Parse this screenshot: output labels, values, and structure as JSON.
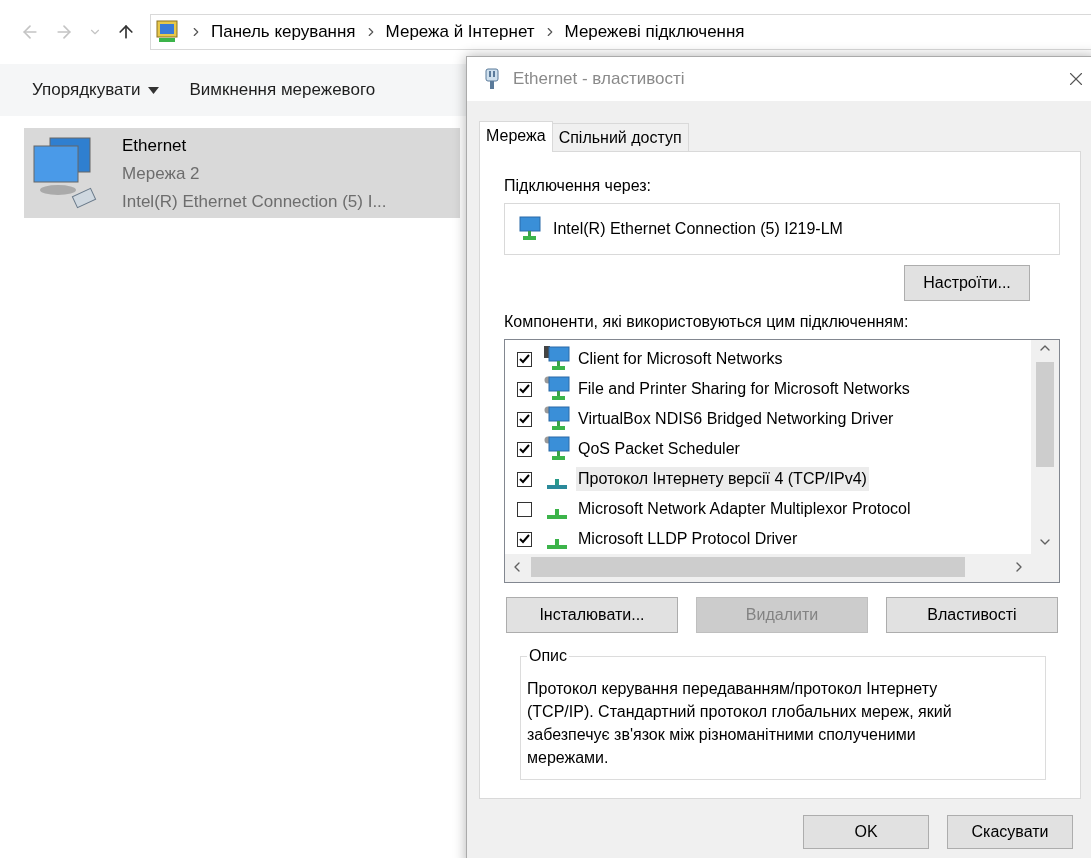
{
  "explorer": {
    "breadcrumb": [
      "Панель керування",
      "Мережа й Інтернет",
      "Мережеві підключення"
    ],
    "toolbar": [
      {
        "label": "Упорядкувати",
        "dropdown": true
      },
      {
        "label": "Вимкнення мережевого",
        "dropdown": false
      }
    ],
    "items": [
      {
        "name": "Ethernet",
        "network": "Мережа 2",
        "adapter": "Intel(R) Ethernet Connection (5) I...",
        "selected": true
      }
    ]
  },
  "dialog": {
    "title": "Ethernet - властивості",
    "tabs": [
      {
        "label": "Мережа",
        "selected": true
      },
      {
        "label": "Спільний доступ",
        "selected": false
      }
    ],
    "connect_using_label": "Підключення через:",
    "adapter": "Intel(R) Ethernet Connection (5) I219-LM",
    "configure_button": "Настроїти...",
    "components_label": "Компоненти, які використовуються цим підключенням:",
    "components": [
      {
        "label": "Client for Microsoft Networks",
        "kind": "client",
        "checked": true,
        "selected": false
      },
      {
        "label": "File and Printer Sharing for Microsoft Networks",
        "kind": "service",
        "checked": true,
        "selected": false
      },
      {
        "label": "VirtualBox NDIS6 Bridged Networking Driver",
        "kind": "service",
        "checked": true,
        "selected": false
      },
      {
        "label": "QoS Packet Scheduler",
        "kind": "service",
        "checked": true,
        "selected": false
      },
      {
        "label": "Протокол Інтернету версії 4 (TCP/IPv4)",
        "kind": "protocol",
        "checked": true,
        "selected": true
      },
      {
        "label": "Microsoft Network Adapter Multiplexor Protocol",
        "kind": "protocol",
        "checked": false,
        "selected": false
      },
      {
        "label": "Microsoft LLDP Protocol Driver",
        "kind": "protocol",
        "checked": true,
        "selected": false
      }
    ],
    "buttons": [
      {
        "label": "Інсталювати...",
        "disabled": false
      },
      {
        "label": "Видалити",
        "disabled": true
      },
      {
        "label": "Властивості",
        "disabled": false
      }
    ],
    "description": {
      "legend": "Опис",
      "text": "Протокол керування передаванням/протокол Інтернету (TCP/IP). Стандартний протокол глобальних мереж, який забезпечує зв'язок між різноманітними сполученими мережами."
    },
    "footer_buttons": [
      "OK",
      "Скасувати"
    ]
  }
}
